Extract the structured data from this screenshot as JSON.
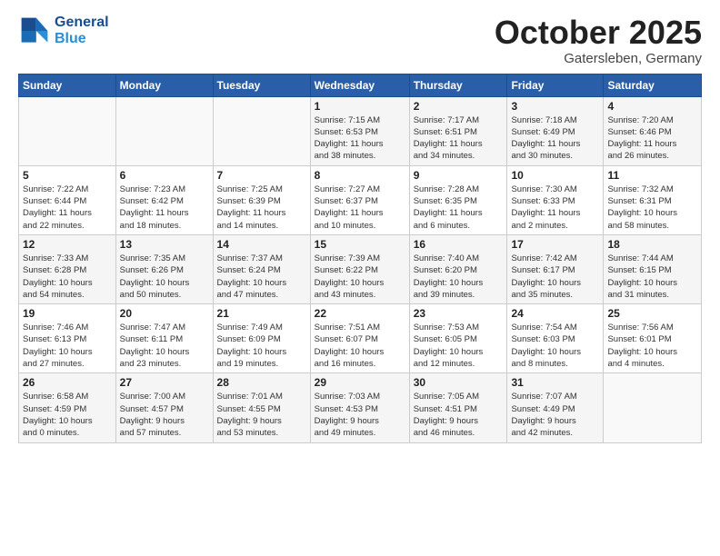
{
  "header": {
    "logo_line1": "General",
    "logo_line2": "Blue",
    "month": "October 2025",
    "location": "Gatersleben, Germany"
  },
  "weekdays": [
    "Sunday",
    "Monday",
    "Tuesday",
    "Wednesday",
    "Thursday",
    "Friday",
    "Saturday"
  ],
  "weeks": [
    [
      {
        "day": "",
        "info": ""
      },
      {
        "day": "",
        "info": ""
      },
      {
        "day": "",
        "info": ""
      },
      {
        "day": "1",
        "info": "Sunrise: 7:15 AM\nSunset: 6:53 PM\nDaylight: 11 hours\nand 38 minutes."
      },
      {
        "day": "2",
        "info": "Sunrise: 7:17 AM\nSunset: 6:51 PM\nDaylight: 11 hours\nand 34 minutes."
      },
      {
        "day": "3",
        "info": "Sunrise: 7:18 AM\nSunset: 6:49 PM\nDaylight: 11 hours\nand 30 minutes."
      },
      {
        "day": "4",
        "info": "Sunrise: 7:20 AM\nSunset: 6:46 PM\nDaylight: 11 hours\nand 26 minutes."
      }
    ],
    [
      {
        "day": "5",
        "info": "Sunrise: 7:22 AM\nSunset: 6:44 PM\nDaylight: 11 hours\nand 22 minutes."
      },
      {
        "day": "6",
        "info": "Sunrise: 7:23 AM\nSunset: 6:42 PM\nDaylight: 11 hours\nand 18 minutes."
      },
      {
        "day": "7",
        "info": "Sunrise: 7:25 AM\nSunset: 6:39 PM\nDaylight: 11 hours\nand 14 minutes."
      },
      {
        "day": "8",
        "info": "Sunrise: 7:27 AM\nSunset: 6:37 PM\nDaylight: 11 hours\nand 10 minutes."
      },
      {
        "day": "9",
        "info": "Sunrise: 7:28 AM\nSunset: 6:35 PM\nDaylight: 11 hours\nand 6 minutes."
      },
      {
        "day": "10",
        "info": "Sunrise: 7:30 AM\nSunset: 6:33 PM\nDaylight: 11 hours\nand 2 minutes."
      },
      {
        "day": "11",
        "info": "Sunrise: 7:32 AM\nSunset: 6:31 PM\nDaylight: 10 hours\nand 58 minutes."
      }
    ],
    [
      {
        "day": "12",
        "info": "Sunrise: 7:33 AM\nSunset: 6:28 PM\nDaylight: 10 hours\nand 54 minutes."
      },
      {
        "day": "13",
        "info": "Sunrise: 7:35 AM\nSunset: 6:26 PM\nDaylight: 10 hours\nand 50 minutes."
      },
      {
        "day": "14",
        "info": "Sunrise: 7:37 AM\nSunset: 6:24 PM\nDaylight: 10 hours\nand 47 minutes."
      },
      {
        "day": "15",
        "info": "Sunrise: 7:39 AM\nSunset: 6:22 PM\nDaylight: 10 hours\nand 43 minutes."
      },
      {
        "day": "16",
        "info": "Sunrise: 7:40 AM\nSunset: 6:20 PM\nDaylight: 10 hours\nand 39 minutes."
      },
      {
        "day": "17",
        "info": "Sunrise: 7:42 AM\nSunset: 6:17 PM\nDaylight: 10 hours\nand 35 minutes."
      },
      {
        "day": "18",
        "info": "Sunrise: 7:44 AM\nSunset: 6:15 PM\nDaylight: 10 hours\nand 31 minutes."
      }
    ],
    [
      {
        "day": "19",
        "info": "Sunrise: 7:46 AM\nSunset: 6:13 PM\nDaylight: 10 hours\nand 27 minutes."
      },
      {
        "day": "20",
        "info": "Sunrise: 7:47 AM\nSunset: 6:11 PM\nDaylight: 10 hours\nand 23 minutes."
      },
      {
        "day": "21",
        "info": "Sunrise: 7:49 AM\nSunset: 6:09 PM\nDaylight: 10 hours\nand 19 minutes."
      },
      {
        "day": "22",
        "info": "Sunrise: 7:51 AM\nSunset: 6:07 PM\nDaylight: 10 hours\nand 16 minutes."
      },
      {
        "day": "23",
        "info": "Sunrise: 7:53 AM\nSunset: 6:05 PM\nDaylight: 10 hours\nand 12 minutes."
      },
      {
        "day": "24",
        "info": "Sunrise: 7:54 AM\nSunset: 6:03 PM\nDaylight: 10 hours\nand 8 minutes."
      },
      {
        "day": "25",
        "info": "Sunrise: 7:56 AM\nSunset: 6:01 PM\nDaylight: 10 hours\nand 4 minutes."
      }
    ],
    [
      {
        "day": "26",
        "info": "Sunrise: 6:58 AM\nSunset: 4:59 PM\nDaylight: 10 hours\nand 0 minutes."
      },
      {
        "day": "27",
        "info": "Sunrise: 7:00 AM\nSunset: 4:57 PM\nDaylight: 9 hours\nand 57 minutes."
      },
      {
        "day": "28",
        "info": "Sunrise: 7:01 AM\nSunset: 4:55 PM\nDaylight: 9 hours\nand 53 minutes."
      },
      {
        "day": "29",
        "info": "Sunrise: 7:03 AM\nSunset: 4:53 PM\nDaylight: 9 hours\nand 49 minutes."
      },
      {
        "day": "30",
        "info": "Sunrise: 7:05 AM\nSunset: 4:51 PM\nDaylight: 9 hours\nand 46 minutes."
      },
      {
        "day": "31",
        "info": "Sunrise: 7:07 AM\nSunset: 4:49 PM\nDaylight: 9 hours\nand 42 minutes."
      },
      {
        "day": "",
        "info": ""
      }
    ]
  ]
}
